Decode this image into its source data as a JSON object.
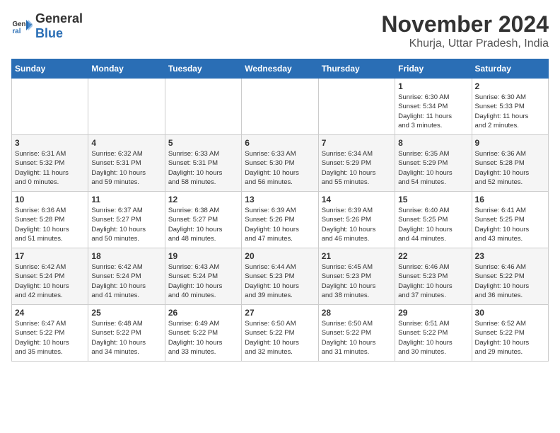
{
  "header": {
    "logo_general": "General",
    "logo_blue": "Blue",
    "title": "November 2024",
    "subtitle": "Khurja, Uttar Pradesh, India"
  },
  "weekdays": [
    "Sunday",
    "Monday",
    "Tuesday",
    "Wednesday",
    "Thursday",
    "Friday",
    "Saturday"
  ],
  "weeks": [
    [
      {
        "day": "",
        "info": ""
      },
      {
        "day": "",
        "info": ""
      },
      {
        "day": "",
        "info": ""
      },
      {
        "day": "",
        "info": ""
      },
      {
        "day": "",
        "info": ""
      },
      {
        "day": "1",
        "info": "Sunrise: 6:30 AM\nSunset: 5:34 PM\nDaylight: 11 hours\nand 3 minutes."
      },
      {
        "day": "2",
        "info": "Sunrise: 6:30 AM\nSunset: 5:33 PM\nDaylight: 11 hours\nand 2 minutes."
      }
    ],
    [
      {
        "day": "3",
        "info": "Sunrise: 6:31 AM\nSunset: 5:32 PM\nDaylight: 11 hours\nand 0 minutes."
      },
      {
        "day": "4",
        "info": "Sunrise: 6:32 AM\nSunset: 5:31 PM\nDaylight: 10 hours\nand 59 minutes."
      },
      {
        "day": "5",
        "info": "Sunrise: 6:33 AM\nSunset: 5:31 PM\nDaylight: 10 hours\nand 58 minutes."
      },
      {
        "day": "6",
        "info": "Sunrise: 6:33 AM\nSunset: 5:30 PM\nDaylight: 10 hours\nand 56 minutes."
      },
      {
        "day": "7",
        "info": "Sunrise: 6:34 AM\nSunset: 5:29 PM\nDaylight: 10 hours\nand 55 minutes."
      },
      {
        "day": "8",
        "info": "Sunrise: 6:35 AM\nSunset: 5:29 PM\nDaylight: 10 hours\nand 54 minutes."
      },
      {
        "day": "9",
        "info": "Sunrise: 6:36 AM\nSunset: 5:28 PM\nDaylight: 10 hours\nand 52 minutes."
      }
    ],
    [
      {
        "day": "10",
        "info": "Sunrise: 6:36 AM\nSunset: 5:28 PM\nDaylight: 10 hours\nand 51 minutes."
      },
      {
        "day": "11",
        "info": "Sunrise: 6:37 AM\nSunset: 5:27 PM\nDaylight: 10 hours\nand 50 minutes."
      },
      {
        "day": "12",
        "info": "Sunrise: 6:38 AM\nSunset: 5:27 PM\nDaylight: 10 hours\nand 48 minutes."
      },
      {
        "day": "13",
        "info": "Sunrise: 6:39 AM\nSunset: 5:26 PM\nDaylight: 10 hours\nand 47 minutes."
      },
      {
        "day": "14",
        "info": "Sunrise: 6:39 AM\nSunset: 5:26 PM\nDaylight: 10 hours\nand 46 minutes."
      },
      {
        "day": "15",
        "info": "Sunrise: 6:40 AM\nSunset: 5:25 PM\nDaylight: 10 hours\nand 44 minutes."
      },
      {
        "day": "16",
        "info": "Sunrise: 6:41 AM\nSunset: 5:25 PM\nDaylight: 10 hours\nand 43 minutes."
      }
    ],
    [
      {
        "day": "17",
        "info": "Sunrise: 6:42 AM\nSunset: 5:24 PM\nDaylight: 10 hours\nand 42 minutes."
      },
      {
        "day": "18",
        "info": "Sunrise: 6:42 AM\nSunset: 5:24 PM\nDaylight: 10 hours\nand 41 minutes."
      },
      {
        "day": "19",
        "info": "Sunrise: 6:43 AM\nSunset: 5:24 PM\nDaylight: 10 hours\nand 40 minutes."
      },
      {
        "day": "20",
        "info": "Sunrise: 6:44 AM\nSunset: 5:23 PM\nDaylight: 10 hours\nand 39 minutes."
      },
      {
        "day": "21",
        "info": "Sunrise: 6:45 AM\nSunset: 5:23 PM\nDaylight: 10 hours\nand 38 minutes."
      },
      {
        "day": "22",
        "info": "Sunrise: 6:46 AM\nSunset: 5:23 PM\nDaylight: 10 hours\nand 37 minutes."
      },
      {
        "day": "23",
        "info": "Sunrise: 6:46 AM\nSunset: 5:22 PM\nDaylight: 10 hours\nand 36 minutes."
      }
    ],
    [
      {
        "day": "24",
        "info": "Sunrise: 6:47 AM\nSunset: 5:22 PM\nDaylight: 10 hours\nand 35 minutes."
      },
      {
        "day": "25",
        "info": "Sunrise: 6:48 AM\nSunset: 5:22 PM\nDaylight: 10 hours\nand 34 minutes."
      },
      {
        "day": "26",
        "info": "Sunrise: 6:49 AM\nSunset: 5:22 PM\nDaylight: 10 hours\nand 33 minutes."
      },
      {
        "day": "27",
        "info": "Sunrise: 6:50 AM\nSunset: 5:22 PM\nDaylight: 10 hours\nand 32 minutes."
      },
      {
        "day": "28",
        "info": "Sunrise: 6:50 AM\nSunset: 5:22 PM\nDaylight: 10 hours\nand 31 minutes."
      },
      {
        "day": "29",
        "info": "Sunrise: 6:51 AM\nSunset: 5:22 PM\nDaylight: 10 hours\nand 30 minutes."
      },
      {
        "day": "30",
        "info": "Sunrise: 6:52 AM\nSunset: 5:22 PM\nDaylight: 10 hours\nand 29 minutes."
      }
    ]
  ]
}
